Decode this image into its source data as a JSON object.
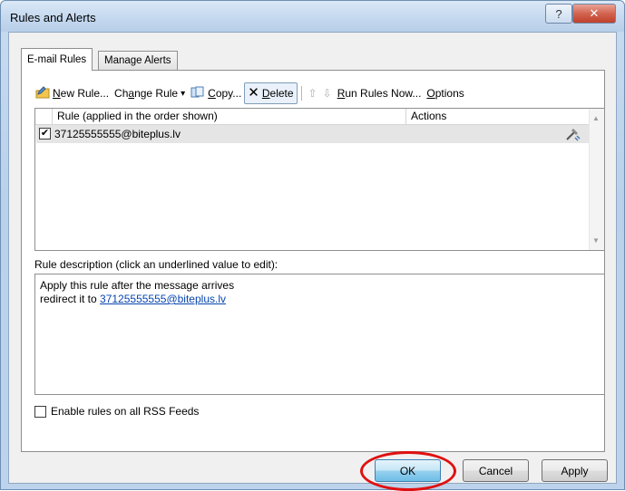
{
  "window": {
    "title": "Rules and Alerts",
    "help_label": "?",
    "close_label": "✕"
  },
  "tabs": [
    {
      "label": "E-mail Rules",
      "active": true
    },
    {
      "label": "Manage Alerts",
      "active": false
    }
  ],
  "toolbar": {
    "new_rule_prefix": "N",
    "new_rule_rest": "ew Rule...",
    "change_rule_prefix": "Ch",
    "change_rule_u": "a",
    "change_rule_rest": "nge Rule",
    "change_rule_arrow": "▾",
    "copy_prefix": "",
    "copy_u": "C",
    "copy_rest": "opy...",
    "delete_u": "D",
    "delete_rest": "elete",
    "move_up": "⇧",
    "move_down": "⇩",
    "run_rules_u": "R",
    "run_rules_rest": "un Rules Now...",
    "options_u": "O",
    "options_rest": "ptions"
  },
  "rules_list": {
    "columns": [
      "Rule (applied in the order shown)",
      "Actions"
    ],
    "rows": [
      {
        "checked": true,
        "name": "37125555555@biteplus.lv"
      }
    ]
  },
  "description": {
    "label": "Rule description (click an underlined value to edit):",
    "line1": "Apply this rule after the message arrives",
    "line2_prefix": "redirect it to ",
    "line2_link": "37125555555@biteplus.lv"
  },
  "rss": {
    "checked": false,
    "label": "Enable rules on all RSS Feeds"
  },
  "buttons": {
    "ok": "OK",
    "cancel": "Cancel",
    "apply": "Apply"
  },
  "colors": {
    "highlight_ring": "#e01010",
    "link": "#0645ad"
  }
}
